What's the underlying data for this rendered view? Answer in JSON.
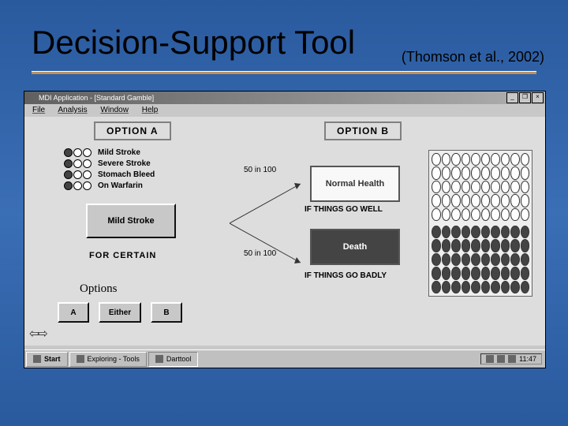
{
  "slide": {
    "title": "Decision-Support Tool",
    "citation": "(Thomson et al., 2002)"
  },
  "window": {
    "title": "MDI Application - [Standard Gamble]",
    "controls": {
      "min": "_",
      "max": "❐",
      "close": "×"
    }
  },
  "menubar": {
    "file": "File",
    "analysis": "Analysis",
    "window": "Window",
    "help": "Help"
  },
  "panels": {
    "a": "OPTION A",
    "b": "OPTION B"
  },
  "legend": {
    "items": [
      {
        "label": "Mild Stroke"
      },
      {
        "label": "Severe Stroke"
      },
      {
        "label": "Stomach Bleed"
      },
      {
        "label": "On Warfarin"
      }
    ]
  },
  "certain": {
    "button": "Mild Stroke",
    "label": "FOR CERTAIN"
  },
  "gamble": {
    "prob_up": "50 in 100",
    "prob_down": "50 in 100",
    "good": "Normal Health",
    "good_if": "IF THINGS GO WELL",
    "bad": "Death",
    "bad_if": "IF THINGS GO BADLY"
  },
  "options": {
    "label": "Options",
    "a": "A",
    "either": "Either",
    "b": "B"
  },
  "taskbar": {
    "start": "Start",
    "task1": "Exploring - Tools",
    "task2": "Darttool",
    "clock": "11:47"
  }
}
